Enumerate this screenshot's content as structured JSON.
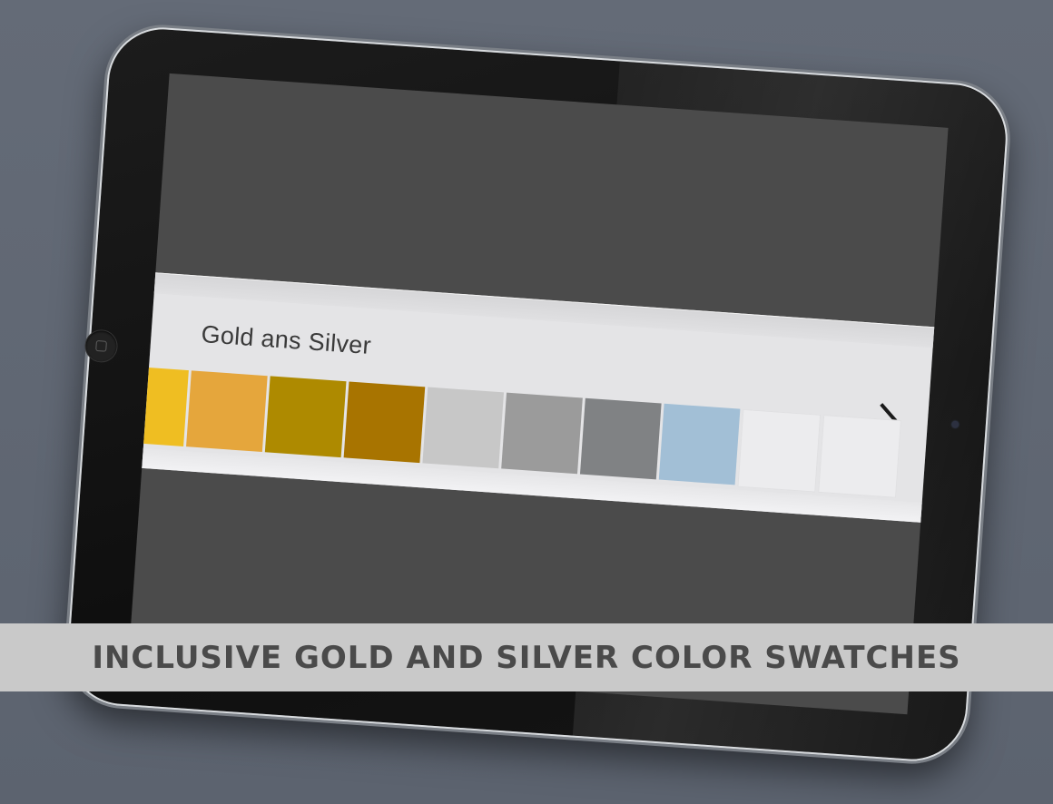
{
  "panel": {
    "title": "Gold ans Silver",
    "swatches": [
      {
        "color": "#efbe22"
      },
      {
        "color": "#e5a63c"
      },
      {
        "color": "#ae8a00"
      },
      {
        "color": "#a87400"
      },
      {
        "color": "#c7c7c7"
      },
      {
        "color": "#9b9b9b"
      },
      {
        "color": "#808284"
      },
      {
        "color": "#a2bfd6"
      },
      {
        "color": "empty"
      },
      {
        "color": "empty"
      }
    ],
    "chevron_icon": "chevron-right-icon"
  },
  "caption": {
    "text": "INCLUSIVE GOLD AND SILVER COLOR SWATCHES"
  },
  "colors": {
    "background": "#5f6672",
    "tablet_bezel": "#141414",
    "screen": "#4b4b4b",
    "panel": "#e4e4e6",
    "caption_band": "#c9c9c9",
    "caption_text": "#4a4a4a"
  }
}
